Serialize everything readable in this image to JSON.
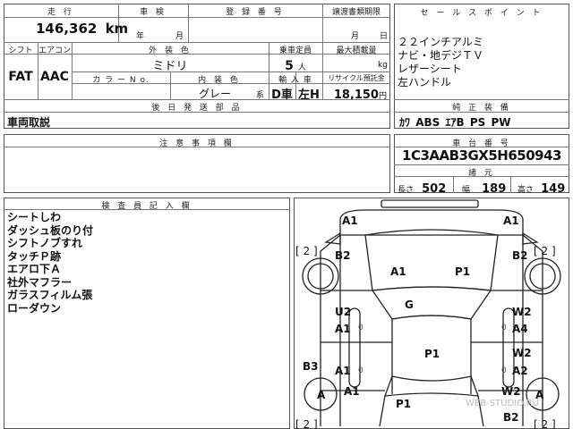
{
  "header": {
    "mileage_label": "走 行",
    "mileage_value": "146,362",
    "mileage_unit": "km",
    "inspection_label": "車 検",
    "inspection_year": "年",
    "inspection_month": "月",
    "registration_label": "登 録 番 号",
    "transfer_label": "譲渡書類期限",
    "transfer_month": "月",
    "transfer_day": "日",
    "shift_label": "シフト",
    "shift_value": "FAT",
    "ac_label": "エアコン",
    "ac_value": "AAC",
    "exterior_label": "外 装 色",
    "exterior_value": "ミドリ",
    "colorno_label": "カ ラ ー N o.",
    "interior_label": "内 装 色",
    "interior_value": "グレー",
    "interior_suffix": "系",
    "capacity_label": "乗車定員",
    "capacity_value": "5",
    "capacity_unit": "人",
    "load_label": "最大積載量",
    "load_unit": "kg",
    "import_label": "輸 入 車",
    "import_value": "D車",
    "handle_value": "左H",
    "recycle_label": "リサイクル預託金",
    "recycle_value": "18,150",
    "recycle_unit": "円",
    "docs_label": "後 日 発 送 部 品",
    "manual_label": "車両取説"
  },
  "sales": {
    "title": "セ ー ル ス ポ イ ン ト",
    "points": [
      "２２インチアルミ",
      "ナビ・地デジＴＶ",
      "レザーシート",
      "左ハンドル"
    ]
  },
  "equipment": {
    "title": "純 正 装 備",
    "items": [
      "ｶﾜ",
      "ABS",
      "ｴｱB",
      "PS",
      "PW"
    ]
  },
  "notes": {
    "title": "注 意 事 項 欄"
  },
  "chassis": {
    "title": "車 台 番 号",
    "value": "1C3AAB3GX5H650943",
    "dims_title": "諸 元",
    "length_label": "長さ",
    "length_value": "502",
    "width_label": "幅",
    "width_value": "189",
    "height_label": "高さ",
    "height_value": "149"
  },
  "inspector": {
    "title": "検 査 員 記 入 欄",
    "comments": [
      "シートしわ",
      "ダッシュ板のり付",
      "シフトノブすれ",
      "タッチＰ跡",
      "エアロ下Ａ",
      "社外マフラー",
      "ガラスフィルム張",
      "ローダウン"
    ]
  },
  "diagram": {
    "marks": {
      "front_left": "A1",
      "front_right": "A1",
      "fender_left": "B2",
      "fender_right": "B2",
      "hood_left": "A1",
      "hood_right": "P1",
      "glass": "G",
      "door_fl_top": "U2",
      "door_fl": "A1",
      "door_fr_top": "W2",
      "door_fr": "A4",
      "roof": "P1",
      "door_rl": "A1",
      "door_rr_top": "W2",
      "door_rr": "A2",
      "sill_left": "B3",
      "rear_l": "A1",
      "rear_r": "W2",
      "trunk": "P1",
      "rear_bumper": "B2",
      "wheel_fl": "2",
      "wheel_fr": "2",
      "wheel_rl": "2",
      "wheel_rr": "2",
      "tire_rl": "A",
      "tire_rr": "A",
      "small_l1": "0",
      "small_l2": "0",
      "small_r1": "0",
      "small_r2": "0"
    },
    "watermark": "WEB-STUDIO.RU"
  }
}
